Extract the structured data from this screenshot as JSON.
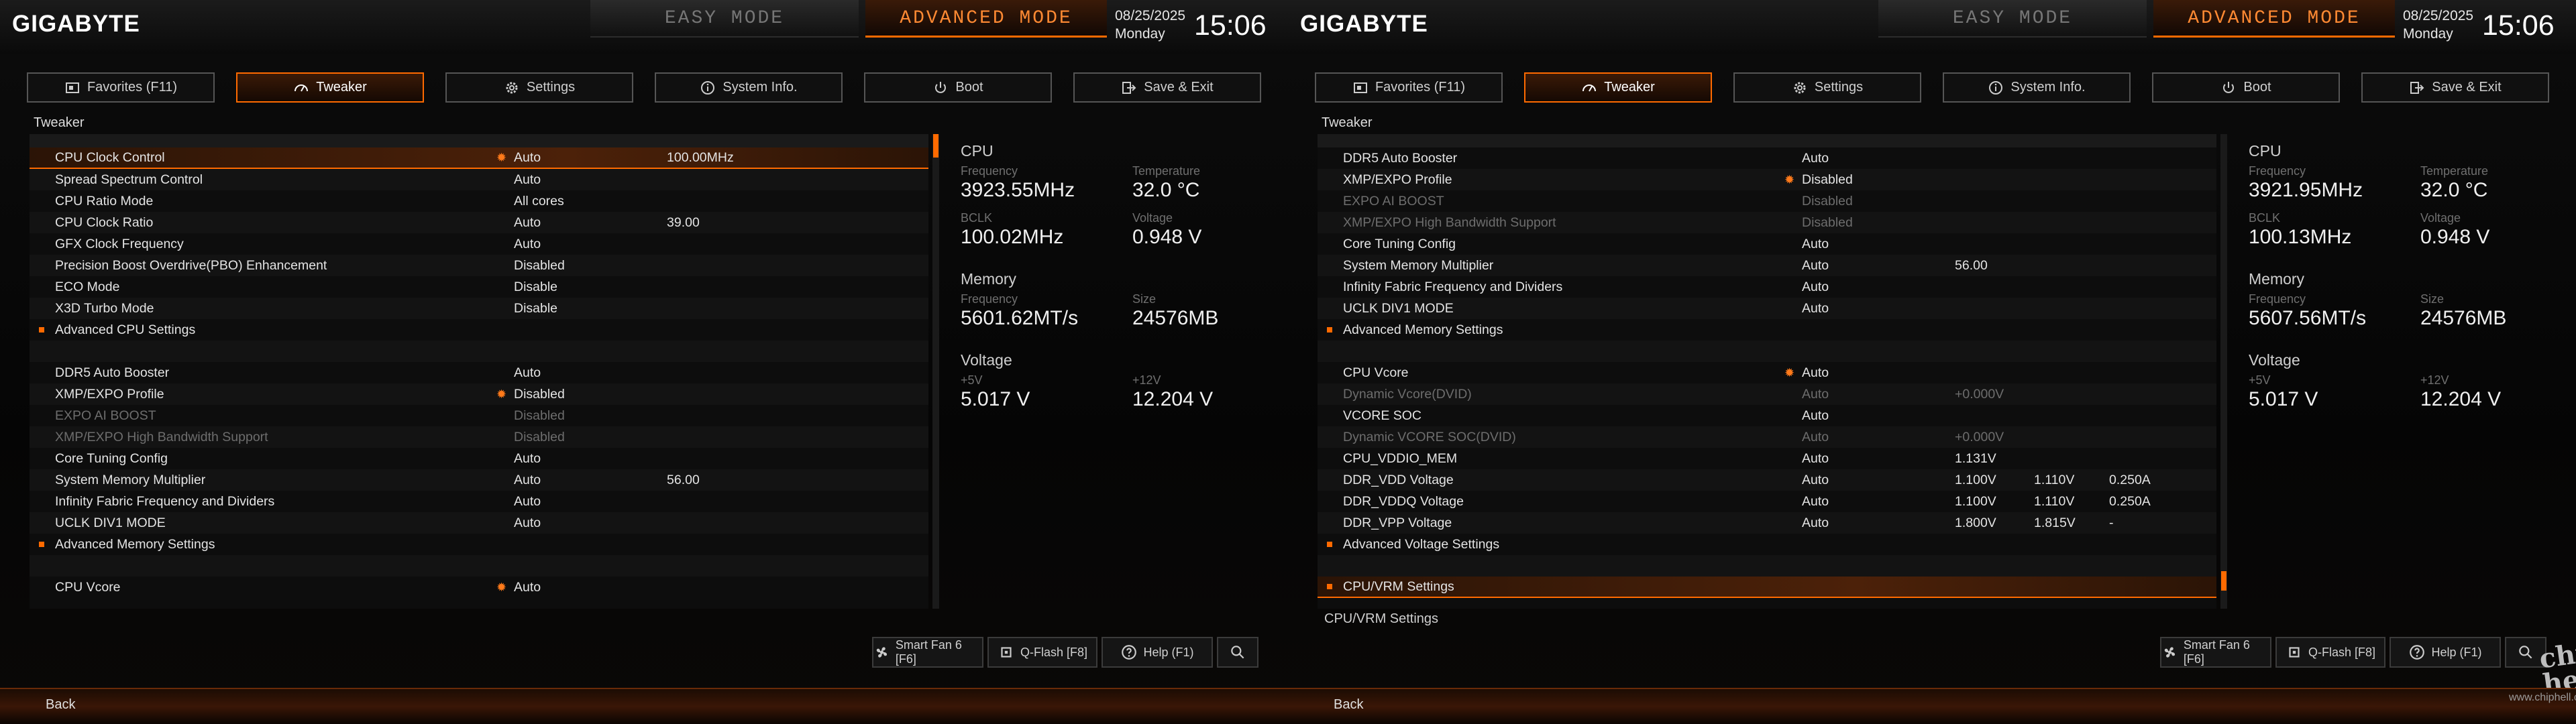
{
  "header": {
    "logo": "GIGABYTE",
    "easy_mode": "EASY MODE",
    "advanced_mode": "ADVANCED MODE",
    "date": "08/25/2025",
    "weekday": "Monday",
    "time": "15:06"
  },
  "tabs": [
    {
      "label": "Favorites (F11)",
      "icon": "favorites-icon"
    },
    {
      "label": "Tweaker",
      "icon": "gauge-icon"
    },
    {
      "label": "Settings",
      "icon": "gear-icon"
    },
    {
      "label": "System Info.",
      "icon": "info-icon"
    },
    {
      "label": "Boot",
      "icon": "power-icon"
    },
    {
      "label": "Save & Exit",
      "icon": "exit-icon"
    }
  ],
  "page_title": "Tweaker",
  "left_rows": [
    {
      "label": "CPU Clock Control",
      "value": "Auto",
      "aux1": "100.00MHz",
      "star": "✹",
      "selected": true
    },
    {
      "label": "Spread Spectrum Control",
      "value": "Auto"
    },
    {
      "label": "CPU Ratio Mode",
      "value": "All cores"
    },
    {
      "label": "CPU Clock Ratio",
      "value": "Auto",
      "aux1": "39.00"
    },
    {
      "label": "GFX Clock Frequency",
      "value": "Auto"
    },
    {
      "label": "Precision Boost Overdrive(PBO) Enhancement",
      "value": "Disabled"
    },
    {
      "label": "ECO Mode",
      "value": "Disable"
    },
    {
      "label": "X3D Turbo Mode",
      "value": "Disable"
    },
    {
      "label": "Advanced CPU Settings",
      "bullet": true
    },
    {
      "empty": true
    },
    {
      "label": "DDR5 Auto Booster",
      "value": "Auto"
    },
    {
      "label": "XMP/EXPO Profile",
      "value": "Disabled",
      "star": "✹"
    },
    {
      "label": "EXPO AI BOOST",
      "value": "Disabled",
      "dim": true
    },
    {
      "label": "XMP/EXPO High Bandwidth Support",
      "value": "Disabled",
      "dim": true
    },
    {
      "label": "Core Tuning Config",
      "value": "Auto"
    },
    {
      "label": "System Memory Multiplier",
      "value": "Auto",
      "aux1": "56.00"
    },
    {
      "label": "Infinity Fabric Frequency and Dividers",
      "value": "Auto"
    },
    {
      "label": "UCLK DIV1 MODE",
      "value": "Auto"
    },
    {
      "label": "Advanced Memory Settings",
      "bullet": true
    },
    {
      "empty": true
    },
    {
      "label": "CPU Vcore",
      "value": "Auto",
      "star": "✹"
    }
  ],
  "right_rows": [
    {
      "label": "DDR5 Auto Booster",
      "value": "Auto"
    },
    {
      "label": "XMP/EXPO Profile",
      "value": "Disabled",
      "star": "✹"
    },
    {
      "label": "EXPO AI BOOST",
      "value": "Disabled",
      "dim": true
    },
    {
      "label": "XMP/EXPO High Bandwidth Support",
      "value": "Disabled",
      "dim": true
    },
    {
      "label": "Core Tuning Config",
      "value": "Auto"
    },
    {
      "label": "System Memory Multiplier",
      "value": "Auto",
      "aux1": "56.00"
    },
    {
      "label": "Infinity Fabric Frequency and Dividers",
      "value": "Auto"
    },
    {
      "label": "UCLK DIV1 MODE",
      "value": "Auto"
    },
    {
      "label": "Advanced Memory Settings",
      "bullet": true
    },
    {
      "empty": true
    },
    {
      "label": "CPU Vcore",
      "value": "Auto",
      "star": "✹"
    },
    {
      "label": "Dynamic Vcore(DVID)",
      "value": "Auto",
      "aux1": "+0.000V",
      "dim": true
    },
    {
      "label": "VCORE SOC",
      "value": "Auto"
    },
    {
      "label": "Dynamic VCORE SOC(DVID)",
      "value": "Auto",
      "aux1": "+0.000V",
      "dim": true
    },
    {
      "label": "CPU_VDDIO_MEM",
      "value": "Auto",
      "aux1": "1.131V"
    },
    {
      "label": "DDR_VDD Voltage",
      "value": "Auto",
      "aux1": "1.100V",
      "aux2": "1.110V",
      "aux3": "0.250A"
    },
    {
      "label": "DDR_VDDQ Voltage",
      "value": "Auto",
      "aux1": "1.100V",
      "aux2": "1.110V",
      "aux3": "0.250A"
    },
    {
      "label": "DDR_VPP Voltage",
      "value": "Auto",
      "aux1": "1.800V",
      "aux2": "1.815V",
      "aux3": "-"
    },
    {
      "label": "Advanced Voltage Settings",
      "bullet": true
    },
    {
      "empty": true
    },
    {
      "label": "CPU/VRM Settings",
      "bullet": true,
      "selected": true
    }
  ],
  "left_info": {
    "cpu_title": "CPU",
    "freq_cap": "Frequency",
    "freq": "3923.55MHz",
    "temp_cap": "Temperature",
    "temp": "32.0 °C",
    "bclk_cap": "BCLK",
    "bclk": "100.02MHz",
    "volt_cap": "Voltage",
    "volt": "0.948 V",
    "mem_title": "Memory",
    "mem_freq_cap": "Frequency",
    "mem_freq": "5601.62MT/s",
    "size_cap": "Size",
    "size": "24576MB",
    "v_title": "Voltage",
    "p5_cap": "+5V",
    "p5": "5.017 V",
    "p12_cap": "+12V",
    "p12": "12.204 V"
  },
  "right_info": {
    "cpu_title": "CPU",
    "freq_cap": "Frequency",
    "freq": "3921.95MHz",
    "temp_cap": "Temperature",
    "temp": "32.0 °C",
    "bclk_cap": "BCLK",
    "bclk": "100.13MHz",
    "volt_cap": "Voltage",
    "volt": "0.948 V",
    "mem_title": "Memory",
    "mem_freq_cap": "Frequency",
    "mem_freq": "5607.56MT/s",
    "size_cap": "Size",
    "size": "24576MB",
    "v_title": "Voltage",
    "p5_cap": "+5V",
    "p5": "5.017 V",
    "p12_cap": "+12V",
    "p12": "12.204 V"
  },
  "right_help": "CPU/VRM Settings",
  "bottom": {
    "smart_fan": "Smart Fan 6 [F6]",
    "qflash": "Q-Flash [F8]",
    "help": "Help (F1)"
  },
  "back": "Back",
  "watermark": "www.chiphell.com",
  "watermark_logo": "chip hell",
  "colors": {
    "accent": "#ff6a00",
    "text": "#e4e4e4",
    "dim": "#6d6d6d"
  },
  "scroll": {
    "left_thumb_fraction": 0.05,
    "left_thumb_pos": 0.0,
    "right_thumb_fraction": 0.04,
    "right_thumb_pos": 0.96
  }
}
